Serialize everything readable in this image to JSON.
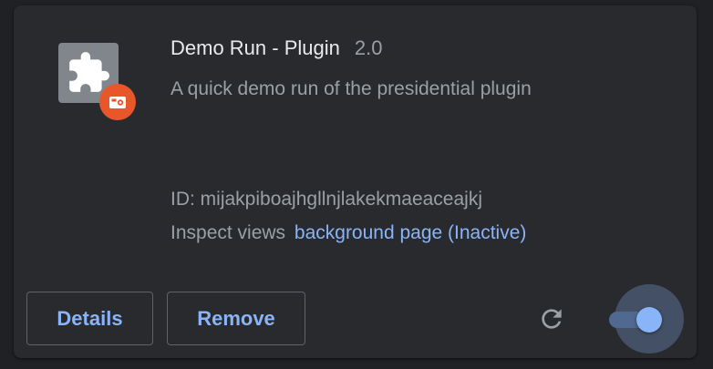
{
  "extension": {
    "name": "Demo Run - Plugin",
    "version": "2.0",
    "description": "A quick demo run of the presidential plugin",
    "id_line": "ID: mijakpiboajhgllnjlakekmaeaceajkj",
    "inspect_label": "Inspect views",
    "inspect_link": "background page (Inactive)",
    "icon": "puzzle-piece-icon",
    "badge_icon": "camera-badge-icon",
    "enabled": true
  },
  "buttons": {
    "details": "Details",
    "remove": "Remove",
    "reload_icon": "reload-icon"
  },
  "colors": {
    "page_background": "#202124",
    "card_background": "#292a2d",
    "primary_text": "#e8eaed",
    "secondary_text": "#9aa0a6",
    "link": "#8ab4f8",
    "badge": "#e8562a",
    "icon_tile": "#80868b"
  }
}
